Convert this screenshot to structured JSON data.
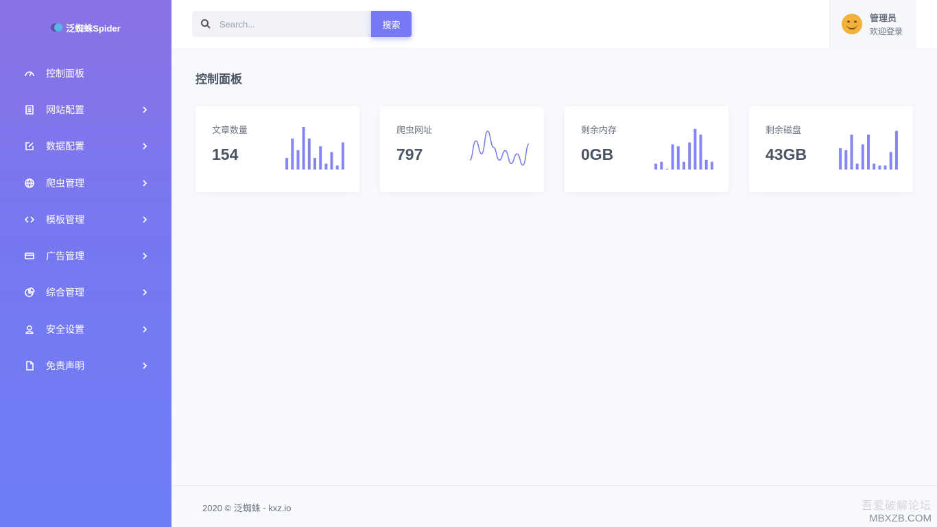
{
  "brand": {
    "name": "泛蜘蛛Spider"
  },
  "sidebar": {
    "items": [
      {
        "label": "控制面板",
        "icon": "dashboard-icon",
        "has_chevron": false
      },
      {
        "label": "网站配置",
        "icon": "document-icon",
        "has_chevron": true
      },
      {
        "label": "数据配置",
        "icon": "edit-icon",
        "has_chevron": true
      },
      {
        "label": "爬虫管理",
        "icon": "globe-icon",
        "has_chevron": true
      },
      {
        "label": "模板管理",
        "icon": "code-icon",
        "has_chevron": true
      },
      {
        "label": "广告管理",
        "icon": "card-icon",
        "has_chevron": true
      },
      {
        "label": "综合管理",
        "icon": "pie-chart-icon",
        "has_chevron": true
      },
      {
        "label": "安全设置",
        "icon": "user-icon",
        "has_chevron": true
      },
      {
        "label": "免责声明",
        "icon": "file-icon",
        "has_chevron": true
      }
    ]
  },
  "header": {
    "search_placeholder": "Search...",
    "search_button": "搜索",
    "user_name": "管理员",
    "user_welcome": "欢迎登录"
  },
  "main": {
    "title": "控制面板",
    "cards": [
      {
        "label": "文章数量",
        "value": "154",
        "chart": "bar",
        "series": [
          3,
          8,
          5,
          11,
          8,
          3,
          6,
          1.5,
          4.5,
          1,
          7
        ]
      },
      {
        "label": "爬虫网址",
        "value": "797",
        "chart": "line",
        "series": [
          2,
          8,
          4,
          11,
          6,
          2,
          5,
          1,
          4,
          0.5,
          7
        ]
      },
      {
        "label": "剩余内存",
        "value": "0GB",
        "chart": "bar",
        "series": [
          1.5,
          2,
          0.2,
          6.5,
          6,
          2,
          7,
          10.5,
          9,
          2.5,
          2
        ]
      },
      {
        "label": "剩余磁盘",
        "value": "43GB",
        "chart": "bar",
        "series": [
          5.5,
          5,
          9,
          1.5,
          6.5,
          9,
          1.5,
          1,
          1,
          4.5,
          10
        ]
      }
    ],
    "accent_color": "#7679f3"
  },
  "footer": {
    "text": "2020 © 泛蜘蛛 - kxz.io",
    "watermark_line1": "吾爱破解论坛",
    "watermark_line2": "MBXZB.COM"
  }
}
